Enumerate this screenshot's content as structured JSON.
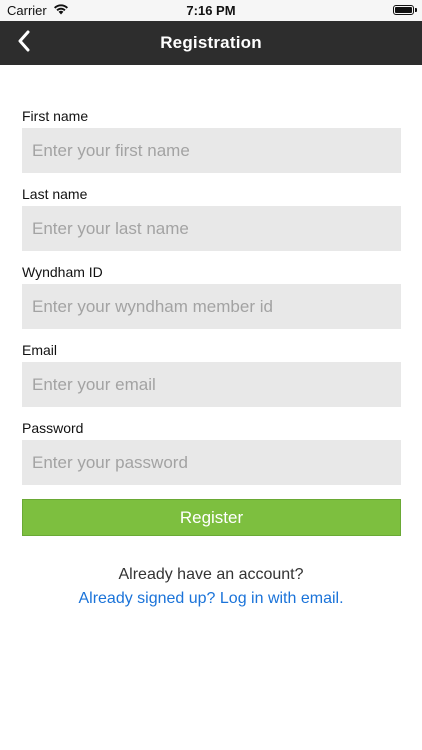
{
  "status_bar": {
    "carrier": "Carrier",
    "time": "7:16 PM",
    "wifi_icon": "wifi-icon",
    "battery_icon": "battery-icon"
  },
  "nav": {
    "title": "Registration",
    "back_icon": "chevron-left-icon",
    "background": "#2d2d2d"
  },
  "form": {
    "first_name": {
      "label": "First name",
      "placeholder": "Enter your first name",
      "value": ""
    },
    "last_name": {
      "label": "Last name",
      "placeholder": "Enter your last name",
      "value": ""
    },
    "wyndham_id": {
      "label": "Wyndham ID",
      "placeholder": "Enter your wyndham member id",
      "value": ""
    },
    "email": {
      "label": "Email",
      "placeholder": "Enter your email",
      "value": ""
    },
    "password": {
      "label": "Password",
      "placeholder": "Enter your password",
      "value": ""
    }
  },
  "register_button": {
    "label": "Register",
    "color": "#7dbf3f"
  },
  "footer": {
    "account_prompt": "Already have an account?",
    "login_link": "Already signed up? Log in with email.",
    "link_color": "#1a73d9"
  }
}
